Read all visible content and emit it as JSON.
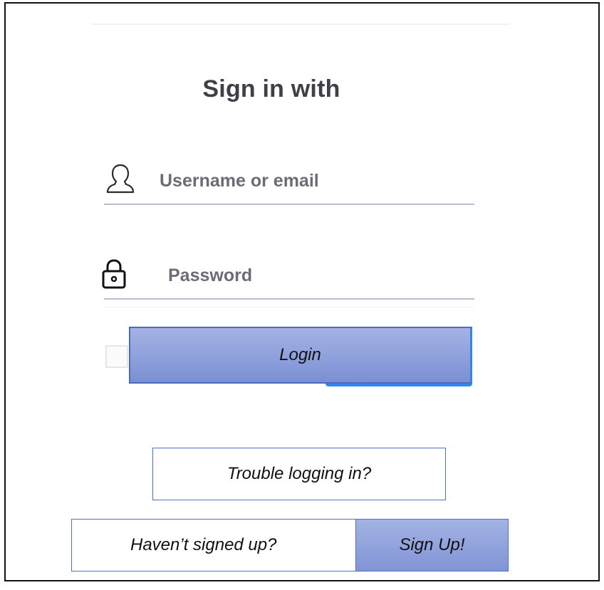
{
  "header": {
    "title": "Sign in with"
  },
  "form": {
    "username": {
      "value": "",
      "placeholder": "Username or email",
      "icon": "user-icon"
    },
    "password": {
      "value": "",
      "placeholder": "Password",
      "icon": "lock-icon"
    },
    "remember_checkbox": {
      "checked": false
    },
    "login_label": "Login"
  },
  "help": {
    "trouble_label": "Trouble logging in?",
    "signup_prompt": "Haven’t signed up?",
    "signup_label": "Sign Up!"
  },
  "colors": {
    "button_fill": "#8ea0dc",
    "button_border": "#4c73c7",
    "accent_blue": "#2f86f0",
    "title_text": "#3f3f4a",
    "placeholder_text": "#6a6c78",
    "underline": "#b9bfd1"
  }
}
